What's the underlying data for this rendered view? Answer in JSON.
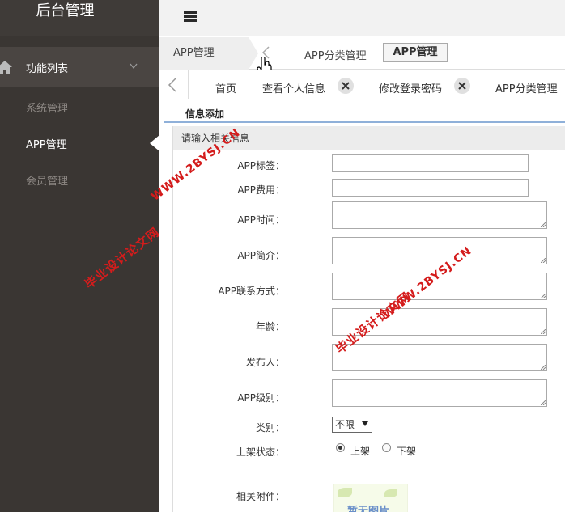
{
  "sidebar": {
    "title": "后台管理",
    "menu_label": "功能列表",
    "items": [
      {
        "label": "系统管理",
        "active": false
      },
      {
        "label": "APP管理",
        "active": true
      },
      {
        "label": "会员管理",
        "active": false
      }
    ]
  },
  "breadcrumb": {
    "first": "APP管理",
    "link": "APP分类管理",
    "current": "APP管理"
  },
  "tabs": [
    {
      "label": "首页",
      "closable": false
    },
    {
      "label": "查看个人信息",
      "closable": true
    },
    {
      "label": "修改登录密码",
      "closable": true
    },
    {
      "label": "APP分类管理",
      "closable": false
    }
  ],
  "section_title": "信息添加",
  "form": {
    "header": "请输入相关信息",
    "fields": {
      "tag": "APP标签：",
      "fee": "APP费用：",
      "time": "APP时间：",
      "intro": "APP简介：",
      "contact": "APP联系方式：",
      "age": "年龄：",
      "publisher": "发布人：",
      "level": "APP级别：",
      "category": "类别：",
      "status": "上架状态：",
      "attachment": "相关附件："
    },
    "category_value": "不限",
    "status_options": [
      "上架",
      "下架"
    ],
    "status_selected": "上架",
    "attachment_placeholder": "暂无图片"
  },
  "watermarks": {
    "site": "WWW.2BYSJ.CN",
    "name": "毕业设计论文网"
  },
  "colors": {
    "sidebar_bg": "#3a3633",
    "watermark": "#d41c1c",
    "section_border": "#8fb0d9"
  }
}
